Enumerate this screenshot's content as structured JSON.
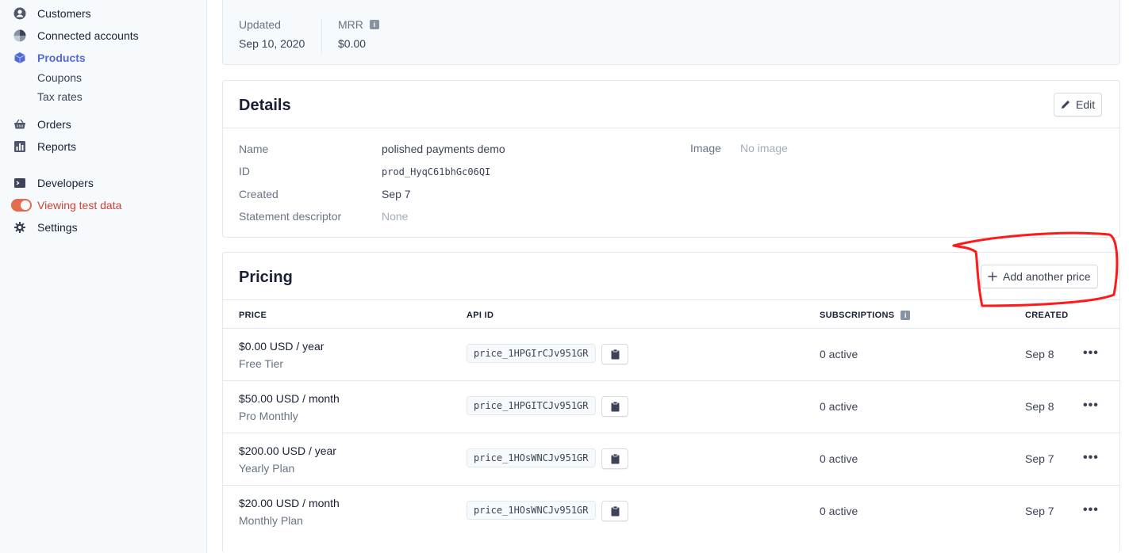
{
  "sidebar": {
    "items": [
      {
        "label": "Customers",
        "icon": "person-circle-icon"
      },
      {
        "label": "Connected accounts",
        "icon": "globe-icon"
      },
      {
        "label": "Products",
        "icon": "cube-icon"
      },
      {
        "label": "Orders",
        "icon": "basket-icon"
      },
      {
        "label": "Reports",
        "icon": "bar-chart-icon"
      },
      {
        "label": "Developers",
        "icon": "terminal-icon"
      },
      {
        "label": "Viewing test data",
        "icon": "toggle-switch"
      },
      {
        "label": "Settings",
        "icon": "gear-icon"
      }
    ],
    "sub_items": [
      "Coupons",
      "Tax rates"
    ]
  },
  "summary": {
    "updated_label": "Updated",
    "updated_value": "Sep 10, 2020",
    "mrr_label": "MRR",
    "mrr_value": "$0.00"
  },
  "details": {
    "title": "Details",
    "edit_label": "Edit",
    "fields": [
      {
        "label": "Name",
        "value": "polished payments demo"
      },
      {
        "label": "ID",
        "value": "prod_HyqC61bhGc06QI"
      },
      {
        "label": "Created",
        "value": "Sep 7"
      },
      {
        "label": "Statement descriptor",
        "value": "None"
      }
    ],
    "image_label": "Image",
    "image_value": "No image"
  },
  "pricing": {
    "title": "Pricing",
    "add_label": "Add another price",
    "columns": [
      "PRICE",
      "API ID",
      "SUBSCRIPTIONS",
      "CREATED"
    ],
    "rows": [
      {
        "price": "$0.00 USD / year",
        "name": "Free Tier",
        "api_id": "price_1HPGIrCJv951GR",
        "subs": "0 active",
        "created": "Sep 8"
      },
      {
        "price": "$50.00 USD / month",
        "name": "Pro Monthly",
        "api_id": "price_1HPGITCJv951GR",
        "subs": "0 active",
        "created": "Sep 8"
      },
      {
        "price": "$200.00 USD / year",
        "name": "Yearly Plan",
        "api_id": "price_1HOsWNCJv951GR",
        "subs": "0 active",
        "created": "Sep 7"
      },
      {
        "price": "$20.00 USD / month",
        "name": "Monthly Plan",
        "api_id": "price_1HOsWNCJv951GR",
        "subs": "0 active",
        "created": "Sep 7"
      }
    ]
  },
  "colors": {
    "accent": "#5469d4",
    "test_mode": "#cd4234",
    "annotation": "#ff1a1a"
  }
}
